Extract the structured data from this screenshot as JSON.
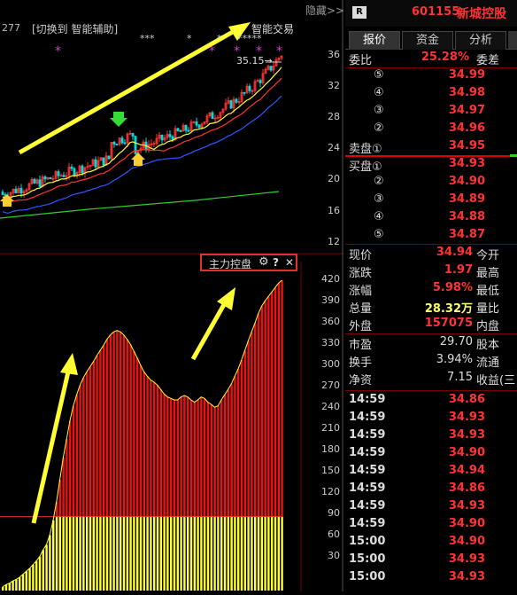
{
  "top_bar": {
    "indicator_value": "277",
    "switch_label": "[切换到 智能辅助]",
    "hide_label": "隐藏>>",
    "smart_trade": "智能交易",
    "max_price_label": "35.15→"
  },
  "price_axis": [
    "36",
    "32",
    "28",
    "24",
    "20",
    "16",
    "12"
  ],
  "sub_panel": {
    "title": "主力控盘",
    "help": "?",
    "close": "✕",
    "axis": [
      "420",
      "390",
      "360",
      "330",
      "300",
      "270",
      "240",
      "210",
      "180",
      "150",
      "120",
      "90",
      "60",
      "30"
    ]
  },
  "right_panel": {
    "badge": "R",
    "code": "601155",
    "name": "新城控股",
    "tabs": [
      "报价",
      "资金",
      "分析"
    ],
    "weibi_label": "委比",
    "weibi_value": "25.28%",
    "weicha_label": "委差",
    "sell": [
      {
        "label": "⑤",
        "price": "34.99"
      },
      {
        "label": "④",
        "price": "34.98"
      },
      {
        "label": "③",
        "price": "34.97"
      },
      {
        "label": "②",
        "price": "34.96"
      },
      {
        "label": "卖盘①",
        "price": "34.95"
      }
    ],
    "buy": [
      {
        "label": "买盘①",
        "price": "34.93"
      },
      {
        "label": "②",
        "price": "34.90"
      },
      {
        "label": "③",
        "price": "34.89"
      },
      {
        "label": "④",
        "price": "34.88"
      },
      {
        "label": "⑤",
        "price": "34.87"
      }
    ],
    "stats": [
      {
        "l": "现价",
        "v": "34.94",
        "r": "今开"
      },
      {
        "l": "涨跌",
        "v": "1.97",
        "r": "最高"
      },
      {
        "l": "涨幅",
        "v": "5.98%",
        "r": "最低"
      },
      {
        "l": "总量",
        "v": "28.32万",
        "r": "量比"
      },
      {
        "l": "外盘",
        "v": "157075",
        "r": "内盘"
      }
    ],
    "stats2": [
      {
        "l": "市盈",
        "v": "29.70",
        "r": "股本"
      },
      {
        "l": "换手",
        "v": "3.94%",
        "r": "流通"
      },
      {
        "l": "净资",
        "v": "7.15",
        "r": "收益(三"
      }
    ],
    "ticks": [
      {
        "t": "14:59",
        "p": "34.86"
      },
      {
        "t": "14:59",
        "p": "34.93"
      },
      {
        "t": "14:59",
        "p": "34.93"
      },
      {
        "t": "14:59",
        "p": "34.90"
      },
      {
        "t": "14:59",
        "p": "34.94"
      },
      {
        "t": "14:59",
        "p": "34.86"
      },
      {
        "t": "14:59",
        "p": "34.93"
      },
      {
        "t": "14:59",
        "p": "34.90"
      },
      {
        "t": "15:00",
        "p": "34.90"
      },
      {
        "t": "15:00",
        "p": "34.93"
      },
      {
        "t": "15:00",
        "p": "34.93"
      }
    ]
  }
}
